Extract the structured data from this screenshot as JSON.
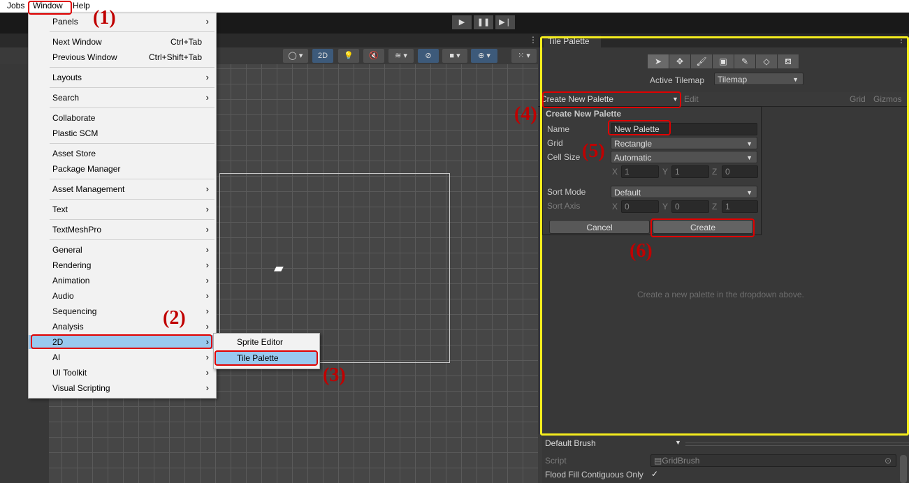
{
  "menubar": {
    "jobs": "Jobs",
    "window": "Window",
    "help": "Help"
  },
  "window_menu": {
    "items": [
      {
        "label": "Panels",
        "shortcut": "",
        "arrow": "›"
      },
      {
        "label": "Next Window",
        "shortcut": "Ctrl+Tab",
        "arrow": ""
      },
      {
        "label": "Previous Window",
        "shortcut": "Ctrl+Shift+Tab",
        "arrow": ""
      },
      {
        "label": "Layouts",
        "shortcut": "",
        "arrow": "›"
      },
      {
        "label": "Search",
        "shortcut": "",
        "arrow": "›"
      },
      {
        "label": "Collaborate",
        "shortcut": "",
        "arrow": ""
      },
      {
        "label": "Plastic SCM",
        "shortcut": "",
        "arrow": ""
      },
      {
        "label": "Asset Store",
        "shortcut": "",
        "arrow": ""
      },
      {
        "label": "Package Manager",
        "shortcut": "",
        "arrow": ""
      },
      {
        "label": "Asset Management",
        "shortcut": "",
        "arrow": "›"
      },
      {
        "label": "Text",
        "shortcut": "",
        "arrow": "›"
      },
      {
        "label": "TextMeshPro",
        "shortcut": "",
        "arrow": "›"
      },
      {
        "label": "General",
        "shortcut": "",
        "arrow": "›"
      },
      {
        "label": "Rendering",
        "shortcut": "",
        "arrow": "›"
      },
      {
        "label": "Animation",
        "shortcut": "",
        "arrow": "›"
      },
      {
        "label": "Audio",
        "shortcut": "",
        "arrow": "›"
      },
      {
        "label": "Sequencing",
        "shortcut": "",
        "arrow": "›"
      },
      {
        "label": "Analysis",
        "shortcut": "",
        "arrow": "›"
      },
      {
        "label": "2D",
        "shortcut": "",
        "arrow": "›"
      },
      {
        "label": "AI",
        "shortcut": "",
        "arrow": "›"
      },
      {
        "label": "UI Toolkit",
        "shortcut": "",
        "arrow": "›"
      },
      {
        "label": "Visual Scripting",
        "shortcut": "",
        "arrow": "›"
      }
    ]
  },
  "submenu_2d": {
    "items": [
      {
        "label": "Sprite Editor"
      },
      {
        "label": "Tile Palette"
      }
    ]
  },
  "scene_toolbar": {
    "mode_2d": "2D"
  },
  "tile_palette": {
    "tab_title": "Tile Palette",
    "active_tilemap_label": "Active Tilemap",
    "active_tilemap_value": "Tilemap",
    "palette_dropdown": "Create New Palette",
    "edit_label": "Edit",
    "grid_label": "Grid",
    "gizmos_label": "Gizmos",
    "empty_hint": "Create a new palette in the dropdown above."
  },
  "create_palette_form": {
    "title": "Create New Palette",
    "name_label": "Name",
    "name_value": "New Palette",
    "grid_label": "Grid",
    "grid_value": "Rectangle",
    "cell_size_label": "Cell Size",
    "cell_size_value": "Automatic",
    "cell_x_label": "X",
    "cell_x": "1",
    "cell_y_label": "Y",
    "cell_y": "1",
    "cell_z_label": "Z",
    "cell_z": "0",
    "sort_mode_label": "Sort Mode",
    "sort_mode_value": "Default",
    "sort_axis_label": "Sort Axis",
    "axis_x_label": "X",
    "axis_x": "0",
    "axis_y_label": "Y",
    "axis_y": "0",
    "axis_z_label": "Z",
    "axis_z": "1",
    "cancel": "Cancel",
    "create": "Create"
  },
  "brush_inspector": {
    "brush_dropdown": "Default Brush",
    "script_label": "Script",
    "script_value": "GridBrush",
    "flood_fill_label": "Flood Fill Contiguous Only",
    "flood_fill_checked": "✓"
  },
  "annotations": {
    "step1": "(1)",
    "step2": "(2)",
    "step3": "(3)",
    "step4": "(4)",
    "step5": "(5)",
    "step6": "(6)"
  }
}
